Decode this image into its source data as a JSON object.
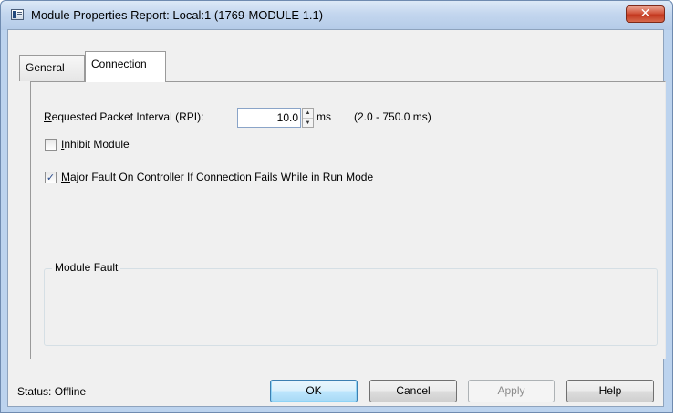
{
  "window": {
    "title": "Module Properties Report: Local:1 (1769-MODULE 1.1)",
    "close_glyph": "✕"
  },
  "tabs": [
    {
      "label": "General",
      "selected": false
    },
    {
      "label": "Connection",
      "selected": true
    }
  ],
  "connection": {
    "rpi_label_accel": "R",
    "rpi_label_rest": "equested Packet Interval (RPI):",
    "rpi_value": "10.0",
    "rpi_unit": "ms",
    "rpi_range": "(2.0 - 750.0 ms)",
    "inhibit_accel": "I",
    "inhibit_rest": "nhibit Module",
    "inhibit_checked": false,
    "major_fault_accel": "M",
    "major_fault_rest": "ajor Fault On Controller If Connection Fails While in Run Mode",
    "major_fault_checked": true,
    "check_glyph": "✓"
  },
  "module_fault": {
    "label": "Module Fault"
  },
  "footer": {
    "status_text": "Status:  Offline",
    "ok_label": "OK",
    "cancel_label": "Cancel",
    "apply_label": "Apply",
    "help_label": "Help"
  },
  "icons": {
    "window_icon": "module-properties-icon",
    "spin_up": "▲",
    "spin_down": "▼"
  }
}
